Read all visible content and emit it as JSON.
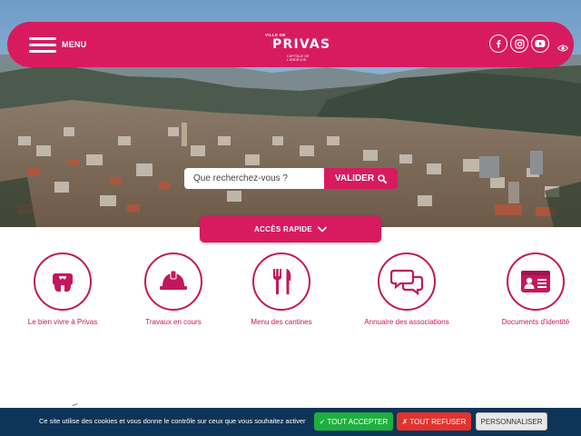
{
  "header": {
    "menu_label": "MENU",
    "logo": {
      "small": "VILLE DE",
      "main": "PRIVAS",
      "sub": "CAPITALE DE L'ARDÈCHE"
    },
    "socials": [
      {
        "icon": "facebook-icon"
      },
      {
        "icon": "instagram-icon"
      },
      {
        "icon": "youtube-icon"
      }
    ],
    "accessibility_icon": "eye-icon"
  },
  "search": {
    "placeholder": "Que recherchez-vous ?",
    "button_label": "VALIDER"
  },
  "quick_access": {
    "label": "ACCÈS RAPIDE"
  },
  "quick_links": [
    {
      "label": "Le bien vivre à Privas",
      "icon": "heart-hands-icon"
    },
    {
      "label": "Travaux en cours",
      "icon": "hard-hat-icon"
    },
    {
      "label": "Menu des cantines",
      "icon": "fork-knife-icon"
    },
    {
      "label": "Annuaire des associations",
      "icon": "chat-bubbles-icon"
    },
    {
      "label": "Documents d'identité",
      "icon": "id-card-icon"
    }
  ],
  "cookie_banner": {
    "text": "Ce site utilise des cookies et vous donne le contrôle sur ceux que vous souhaitez activer",
    "accept": "✓ TOUT ACCEPTER",
    "refuse": "✗ TOUT REFUSER",
    "customize": "PERSONNALISER"
  },
  "colors": {
    "brand": "#d81b5f",
    "icon_outline": "#c2185b",
    "banner": "#0e3558",
    "accept": "#1eb03c",
    "refuse": "#e2332e"
  }
}
